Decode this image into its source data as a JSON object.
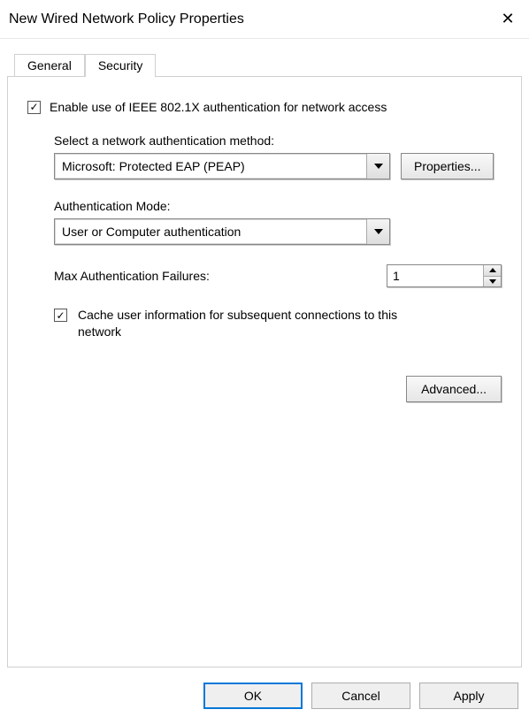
{
  "window": {
    "title": "New Wired Network Policy Properties"
  },
  "tabs": {
    "general": "General",
    "security": "Security"
  },
  "security": {
    "enable_label": "Enable use of IEEE 802.1X authentication for network access",
    "enable_checked": true,
    "auth_method_label": "Select a network authentication method:",
    "auth_method_value": "Microsoft: Protected EAP (PEAP)",
    "properties_btn": "Properties...",
    "auth_mode_label": "Authentication Mode:",
    "auth_mode_value": "User or Computer authentication",
    "max_failures_label": "Max Authentication Failures:",
    "max_failures_value": "1",
    "cache_checked": true,
    "cache_label": "Cache user information for subsequent connections to this network",
    "advanced_btn": "Advanced..."
  },
  "footer": {
    "ok": "OK",
    "cancel": "Cancel",
    "apply": "Apply"
  }
}
